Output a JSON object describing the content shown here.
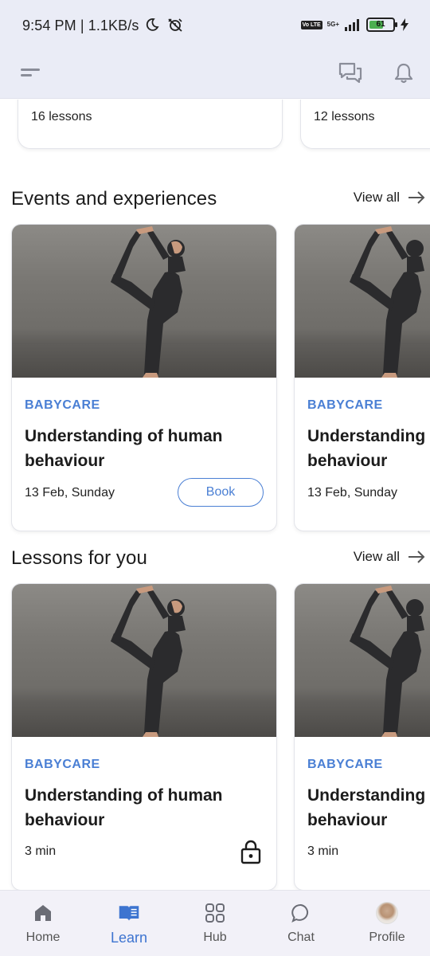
{
  "status_bar": {
    "time": "9:54 PM | 1.1KB/s",
    "network_badge": "Vo LTE",
    "network_type": "5G+",
    "battery": "61",
    "battery_level": 0.61
  },
  "header": {
    "menu_icon": "menu-icon",
    "chat_icon": "chat-bubbles-icon",
    "bell_icon": "bell-icon"
  },
  "courses": [
    {
      "lessons": "16 lessons"
    },
    {
      "lessons": "12 lessons"
    }
  ],
  "events": {
    "title": "Events and experiences",
    "view_all": "View all",
    "cards": [
      {
        "category": "BABYCARE",
        "title": "Understanding of human behaviour",
        "date": "13 Feb, Sunday",
        "action": "Book"
      },
      {
        "category": "BABYCARE",
        "title": "Understanding of human behaviour",
        "date": "13 Feb, Sunday"
      }
    ]
  },
  "lessons": {
    "title": "Lessons for you",
    "view_all": "View all",
    "cards": [
      {
        "category": "BABYCARE",
        "title": "Understanding of human behaviour",
        "duration": "3 min",
        "locked": true
      },
      {
        "category": "BABYCARE",
        "title": "Understanding of human behaviour",
        "duration": "3 min"
      }
    ]
  },
  "bottom_nav": {
    "items": [
      {
        "label": "Home",
        "icon": "home-icon"
      },
      {
        "label": "Learn",
        "icon": "book-icon",
        "active": true
      },
      {
        "label": "Hub",
        "icon": "grid-icon"
      },
      {
        "label": "Chat",
        "icon": "chat-icon"
      },
      {
        "label": "Profile",
        "icon": "avatar"
      }
    ]
  },
  "colors": {
    "accent": "#4a7fd4",
    "header_bg": "#eaecf6",
    "nav_bg": "#f2f1f8"
  }
}
